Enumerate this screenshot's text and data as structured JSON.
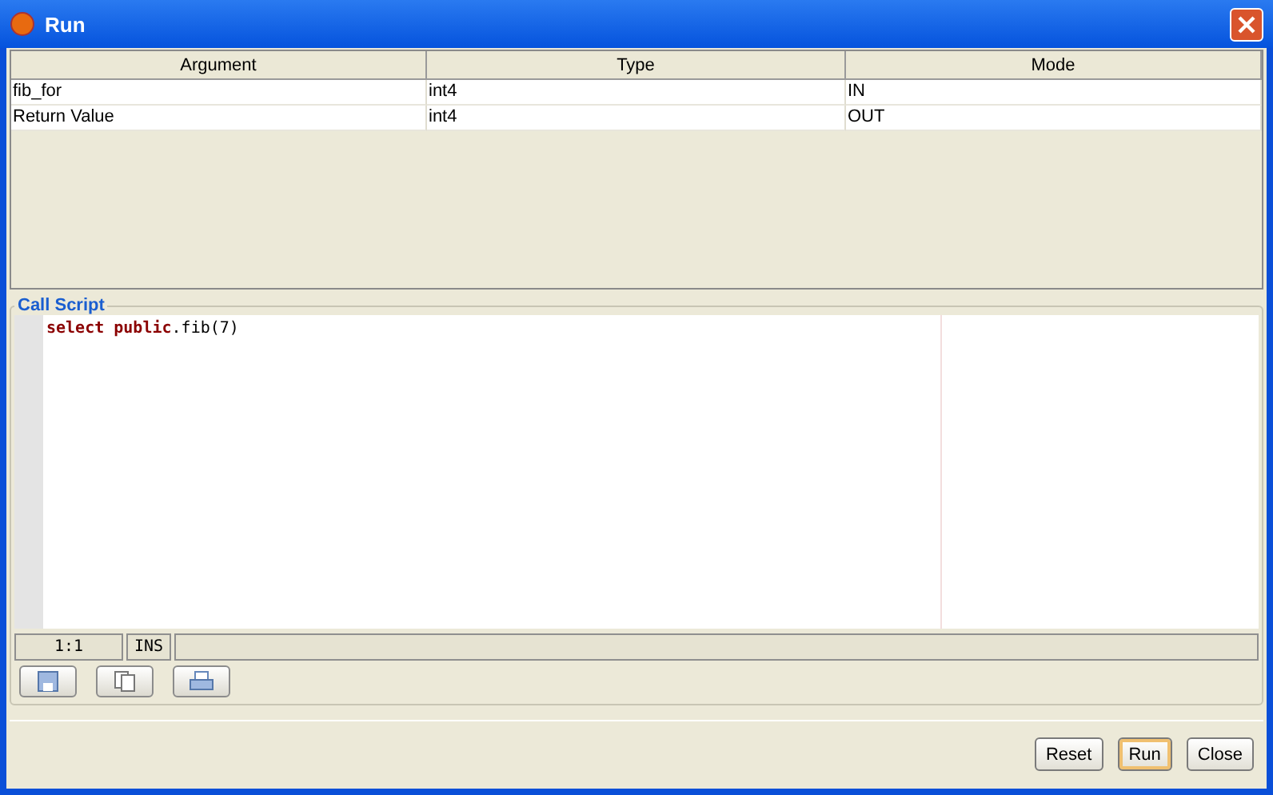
{
  "window": {
    "title": "Run"
  },
  "table": {
    "columns": [
      "Argument",
      "Type",
      "Mode"
    ],
    "rows": [
      [
        "fib_for",
        "int4",
        "IN"
      ],
      [
        "Return Value",
        "int4",
        "OUT"
      ]
    ]
  },
  "call_script": {
    "title": "Call Script",
    "tokens": [
      {
        "text": "select public",
        "kind": "keyword"
      },
      {
        "text": ".fib(7)",
        "kind": "plain"
      }
    ],
    "status": {
      "position": "1:1",
      "mode": "INS"
    }
  },
  "buttons": [
    {
      "label": "Reset",
      "default": false
    },
    {
      "label": "Run",
      "default": true
    },
    {
      "label": "Close",
      "default": false
    }
  ]
}
